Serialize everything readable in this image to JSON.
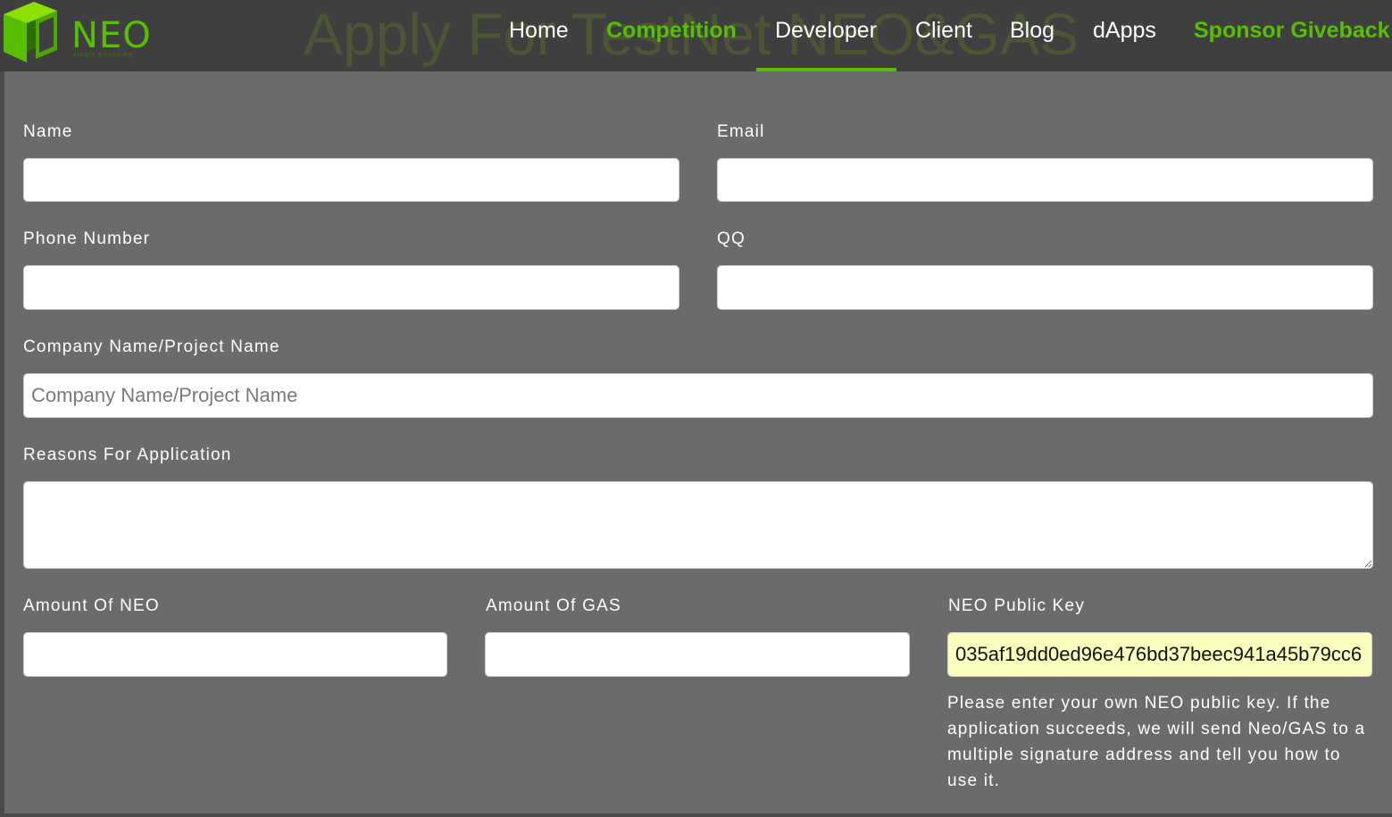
{
  "header": {
    "logo": {
      "text": "NEO",
      "tagline": "smart economy",
      "icon": "neo-logo-icon"
    },
    "ghost_title": "Apply For TestNet NEO&GAS",
    "nav": [
      {
        "label": "Home",
        "accent": false,
        "active": false
      },
      {
        "label": "Competition",
        "accent": true,
        "active": false
      },
      {
        "label": "Developer",
        "accent": false,
        "active": true
      },
      {
        "label": "Client",
        "accent": false,
        "active": false
      },
      {
        "label": "Blog",
        "accent": false,
        "active": false
      },
      {
        "label": "dApps",
        "accent": false,
        "active": false
      },
      {
        "label": "Sponsor Giveback",
        "accent": true,
        "active": false
      }
    ]
  },
  "form": {
    "name": {
      "label": "Name",
      "value": "",
      "placeholder": ""
    },
    "email": {
      "label": "Email",
      "value": "",
      "placeholder": ""
    },
    "phone": {
      "label": "Phone Number",
      "value": "",
      "placeholder": ""
    },
    "qq": {
      "label": "QQ",
      "value": "",
      "placeholder": ""
    },
    "company": {
      "label": "Company Name/Project Name",
      "value": "",
      "placeholder": "Company Name/Project Name"
    },
    "reasons": {
      "label": "Reasons For Application",
      "value": "",
      "placeholder": ""
    },
    "neo_amount": {
      "label": "Amount Of NEO",
      "value": "",
      "placeholder": ""
    },
    "gas_amount": {
      "label": "Amount Of GAS",
      "value": "",
      "placeholder": ""
    },
    "public_key": {
      "label": "NEO Public Key",
      "value": "035af19dd0ed96e476bd37beec941a45b79cc6",
      "help": "Please enter your own NEO public key. If the application succeeds, we will send Neo/GAS to a multiple signature address and tell you how to use it."
    }
  },
  "colors": {
    "accent": "#58bf00",
    "header_bg": "#3f3f3f",
    "content_bg": "#6b6b6b",
    "autofill_bg": "#faffbd"
  }
}
